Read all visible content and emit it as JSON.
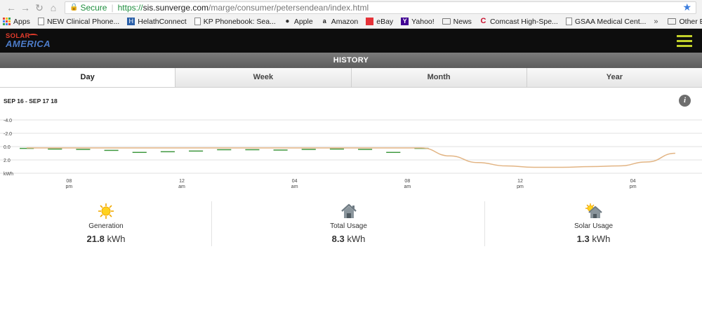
{
  "browser": {
    "secure_label": "Secure",
    "url_scheme": "https://",
    "url_host": "sis.sunverge.com",
    "url_path": "/marge/consumer/petersendean/index.html",
    "bookmarks": [
      "Apps",
      "NEW Clinical Phone...",
      "HelathConnect",
      "KP Phonebook: Sea...",
      "Apple",
      "Amazon",
      "eBay",
      "Yahoo!",
      "News",
      "Comcast High-Spe...",
      "GSAA Medical Cent..."
    ],
    "other_bookmarks": "Other Bookmarks",
    "overflow": "»"
  },
  "app": {
    "logo_top": "SOLAR",
    "logo_bottom": "AMERICA",
    "section_title": "HISTORY",
    "tabs": [
      "Day",
      "Week",
      "Month",
      "Year"
    ],
    "active_tab": "Day",
    "date_range": "SEP 16 - SEP 17 18",
    "info_glyph": "i"
  },
  "colors": {
    "generation_bar": "#5f7a5a",
    "generation_bar_top": "#3f9a3f",
    "usage_bar": "#3aa0f0",
    "usage_line": "#e2b483",
    "selection": "#e6f0fb"
  },
  "chart_data": {
    "type": "bar",
    "unit_label": "kWh",
    "y_ticks": [
      "2.0",
      "0.0",
      "-2.0",
      "-4.0"
    ],
    "ylim": [
      -4.0,
      4.0
    ],
    "x_ticks": [
      {
        "hour": 2,
        "label_top": "08",
        "label_bottom": "pm"
      },
      {
        "hour": 6,
        "label_top": "12",
        "label_bottom": "am"
      },
      {
        "hour": 10,
        "label_top": "04",
        "label_bottom": "am"
      },
      {
        "hour": 14,
        "label_top": "08",
        "label_bottom": "am"
      },
      {
        "hour": 18,
        "label_top": "12",
        "label_bottom": "pm"
      },
      {
        "hour": 22,
        "label_top": "04",
        "label_bottom": "pm"
      }
    ],
    "selection_hours": [
      0,
      7
    ],
    "series": [
      {
        "name": "Generation",
        "values": [
          0.2,
          0.3,
          0.35,
          0.5,
          0.8,
          0.7,
          0.6,
          0.4,
          0.4,
          0.45,
          0.35,
          0.3,
          0.35,
          0.8,
          0.2,
          -0.6,
          -1.8,
          -2.3,
          -2.6,
          -2.5,
          -2.3,
          -2.1,
          -1.4,
          -0.5
        ]
      },
      {
        "name": "Usage",
        "values": [
          0.2,
          0.2,
          0.2,
          0.2,
          0.2,
          0.2,
          0.2,
          0.2,
          0.2,
          0.2,
          0.2,
          0.2,
          0.2,
          0.2,
          0.2,
          1.4,
          2.4,
          2.9,
          3.1,
          3.1,
          3.0,
          2.9,
          2.3,
          1.0
        ]
      }
    ]
  },
  "stats": [
    {
      "label": "Generation",
      "value": "21.8",
      "unit": "kWh",
      "icon": "sun-icon"
    },
    {
      "label": "Total Usage",
      "value": "8.3",
      "unit": "kWh",
      "icon": "home-icon"
    },
    {
      "label": "Solar Usage",
      "value": "1.3",
      "unit": "kWh",
      "icon": "solar-home-icon"
    }
  ]
}
